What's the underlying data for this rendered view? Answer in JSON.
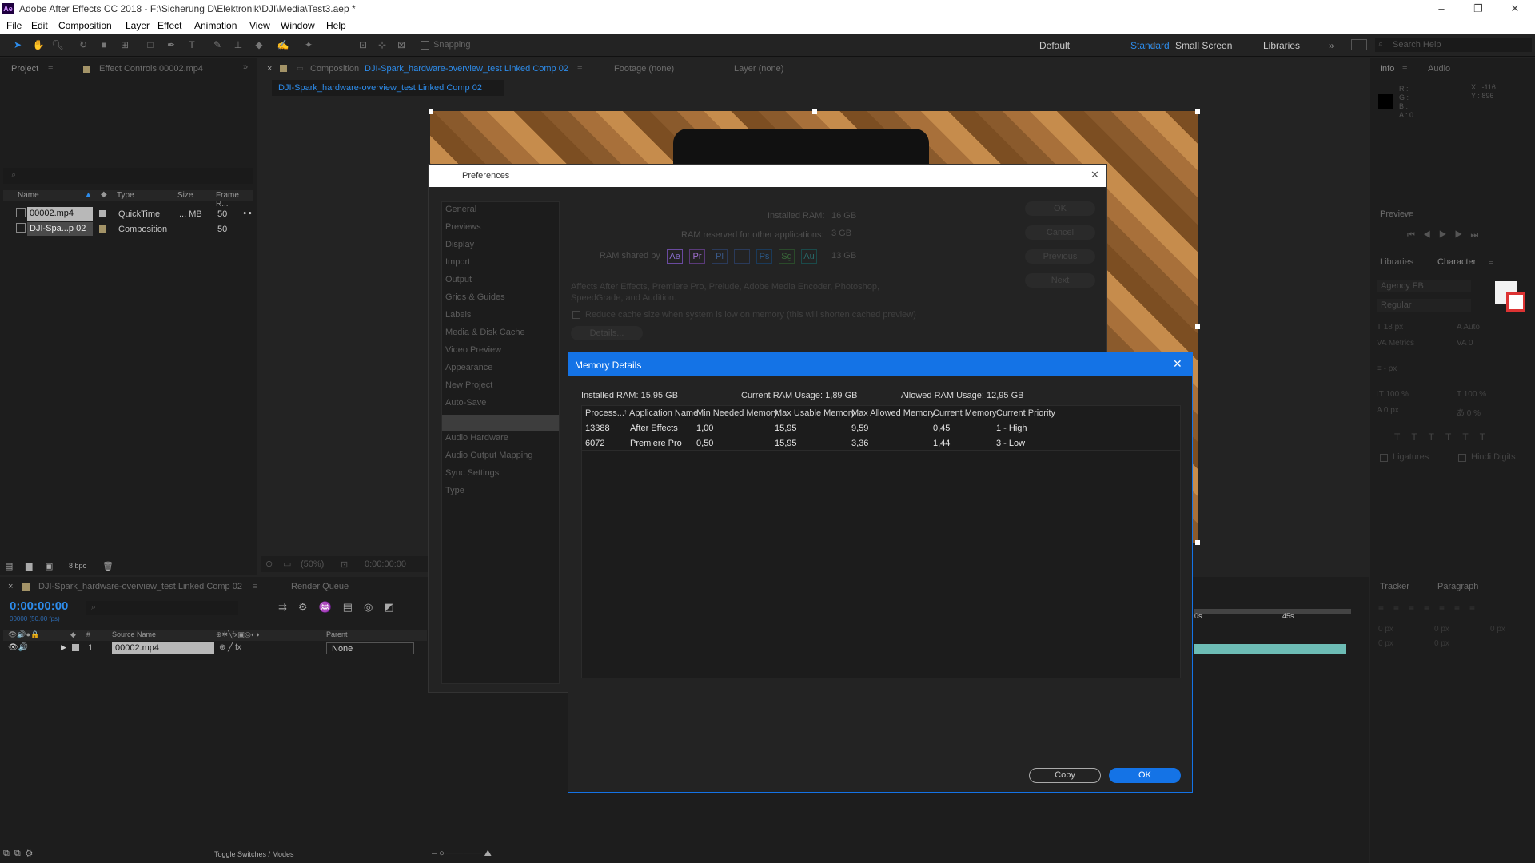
{
  "app": {
    "title": "Adobe After Effects CC 2018 - F:\\Sicherung D\\Elektronik\\DJI\\Media\\Test3.aep *",
    "logo": "Ae"
  },
  "menu": [
    "File",
    "Edit",
    "Composition",
    "Layer",
    "Effect",
    "Animation",
    "View",
    "Window",
    "Help"
  ],
  "toolbar": {
    "snapping": "Snapping",
    "workspaces": [
      "Default",
      "Standard",
      "Small Screen",
      "Libraries"
    ],
    "search_placeholder": "Search Help"
  },
  "project_panel": {
    "tab": "Project",
    "effect_controls": "Effect Controls 00002.mp4",
    "columns": [
      "Name",
      "Type",
      "Size",
      "Frame R..."
    ],
    "items": [
      {
        "name": "00002.mp4",
        "type": "QuickTime",
        "size": "... MB",
        "fps": "50"
      },
      {
        "name": "DJI-Spa...p 02",
        "type": "Composition",
        "size": "",
        "fps": "50"
      }
    ],
    "bpc": "8 bpc"
  },
  "comp_panel": {
    "tab_prefix": "Composition",
    "comp_name": "DJI-Spark_hardware-overview_test Linked Comp 02",
    "footage": "Footage (none)",
    "layer": "Layer (none)",
    "breadcrumb": "DJI-Spark_hardware-overview_test Linked Comp 02",
    "zoom": "(50%)",
    "time": "0:00:00:00"
  },
  "info_panel": {
    "tab": "Info",
    "audio": "Audio",
    "r": "R :",
    "g": "G :",
    "b": "B :",
    "a": "A : 0",
    "x": "X : -116",
    "y": "Y : 896"
  },
  "preview_panel": {
    "tab": "Preview"
  },
  "character_panel": {
    "libraries": "Libraries",
    "tab": "Character",
    "font": "Agency FB",
    "style": "Regular",
    "size": "18 px",
    "leading": "Auto",
    "kerning": "Metrics",
    "tracking": "0",
    "unit": "- px",
    "vscale": "100 %",
    "hscale": "100 %",
    "baseline": "0 px",
    "tsume": "0 %",
    "ligatures": "Ligatures",
    "hindi": "Hindi Digits"
  },
  "tracker_panel": {
    "tab": "Tracker",
    "paragraph": "Paragraph",
    "px": [
      "0 px",
      "0 px",
      "0 px",
      "0 px",
      "0 px"
    ]
  },
  "timeline": {
    "tab": "DJI-Spark_hardware-overview_test Linked Comp 02",
    "render_queue": "Render Queue",
    "timecode": "0:00:00:00",
    "frames": "00000 (50.00 fps)",
    "col_source": "Source Name",
    "col_parent": "Parent",
    "layer_num": "1",
    "layer_name": "00002.mp4",
    "parent_value": "None",
    "toggle": "Toggle Switches / Modes",
    "ruler": [
      "0s",
      "45s"
    ]
  },
  "preferences": {
    "title": "Preferences",
    "categories": [
      "General",
      "Previews",
      "Display",
      "Import",
      "Output",
      "Grids & Guides",
      "Labels",
      "Media & Disk Cache",
      "Video Preview",
      "Appearance",
      "New Project",
      "Auto-Save",
      "",
      "Audio Hardware",
      "Audio Output Mapping",
      "Sync Settings",
      "Type"
    ],
    "installed_ram_label": "Installed RAM:",
    "installed_ram": "16 GB",
    "reserved_label": "RAM reserved for other applications:",
    "reserved": "3 GB",
    "shared_label": "RAM shared by",
    "shared_apps": [
      "Ae",
      "Pr",
      "Pl",
      "",
      "Ps",
      "Sg",
      "Au"
    ],
    "shared": "13 GB",
    "affects": "Affects After Effects, Premiere Pro, Prelude, Adobe Media Encoder, Photoshop, SpeedGrade, and Audition.",
    "reduce_cache": "Reduce cache size when system is low on memory (this will shorten cached preview)",
    "details": "Details...",
    "buttons": [
      "OK",
      "Cancel",
      "Previous",
      "Next"
    ]
  },
  "memory": {
    "title": "Memory Details",
    "installed": "Installed RAM: 15,95 GB",
    "current": "Current RAM Usage: 1,89 GB",
    "allowed": "Allowed RAM Usage: 12,95 GB",
    "columns": [
      "Process...",
      "Application Name",
      "Min Needed Memory",
      "Max Usable Memory",
      "Max Allowed Memory",
      "Current Memory",
      "Current Priority"
    ],
    "rows": [
      [
        "13388",
        "After Effects",
        "1,00",
        "15,95",
        "9,59",
        "0,45",
        "1 - High"
      ],
      [
        "6072",
        "Premiere Pro",
        "0,50",
        "15,95",
        "3,36",
        "1,44",
        "3 - Low"
      ]
    ],
    "copy": "Copy",
    "ok": "OK"
  }
}
